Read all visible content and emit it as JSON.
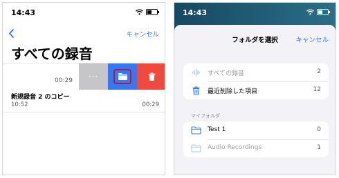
{
  "left_screen": {
    "status_time": "14:43",
    "cancel_label": "キャンセル",
    "title": "すべての録音",
    "row1": {
      "duration": "00:29",
      "more_label": "···"
    },
    "row2": {
      "title": "新規録音 2 のコピー",
      "time": "10:52",
      "duration": "00:29"
    }
  },
  "right_screen": {
    "status_time": "14:43",
    "sheet_title": "フォルダを選択",
    "cancel_label": "キャンセル",
    "top_group": [
      {
        "label": "すべての録音",
        "count": "2",
        "icon": "waveform-icon"
      },
      {
        "label": "最近削除した項目",
        "count": "12",
        "icon": "trash-icon"
      }
    ],
    "my_folders_label": "マイフォルダ",
    "my_folders": [
      {
        "label": "Test 1",
        "count": "0",
        "icon": "folder-icon"
      },
      {
        "label": "Audio Recordings",
        "count": "1",
        "icon": "folder-icon"
      }
    ]
  },
  "colors": {
    "accent": "#2f7cf6",
    "move_action": "#3478f6",
    "delete_action": "#ef4a3d",
    "more_action": "#c6c6c8",
    "focus_ring": "#b01b38"
  }
}
